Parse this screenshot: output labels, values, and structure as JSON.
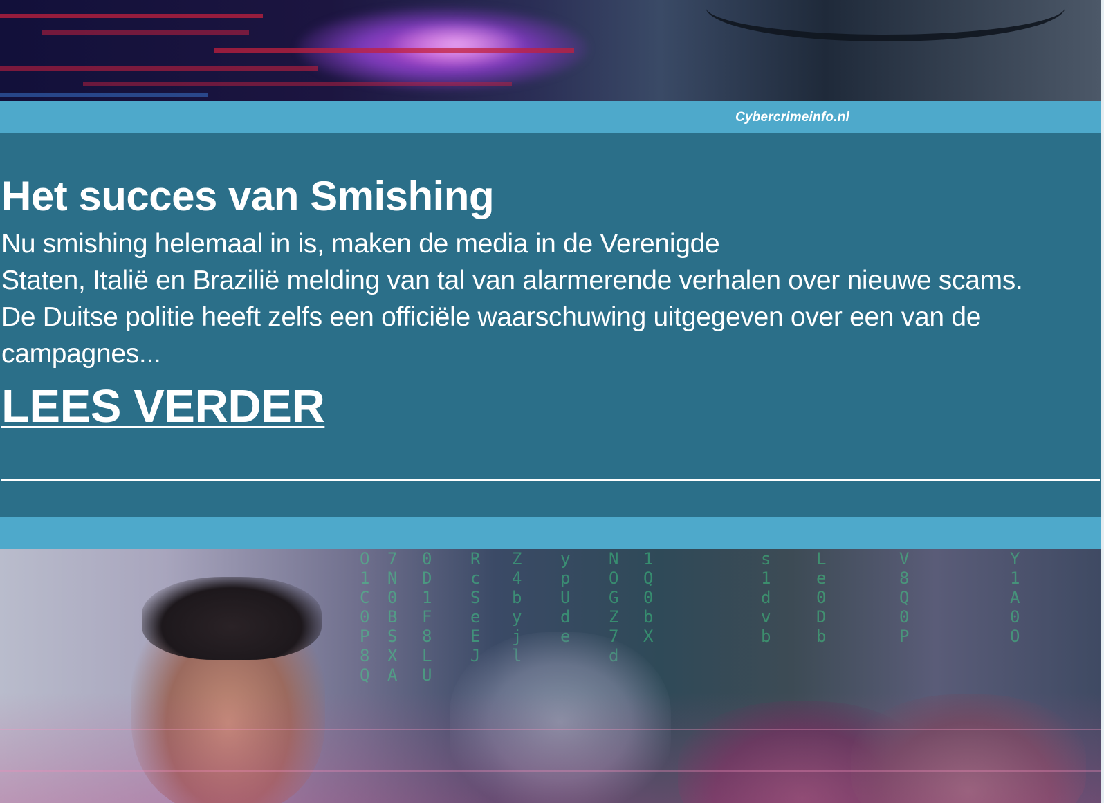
{
  "hero_top": {
    "caption": "Cybercrimeinfo.nl"
  },
  "article": {
    "title": "Het succes van Smishing",
    "body_lines": [
      "Nu smishing helemaal in is, maken de media in de Verenigde",
      "Staten, Italië en Brazilië melding van tal van alarmerende verhalen over nieuwe scams.",
      "De Duitse politie heeft zelfs een officiële waarschuwing uitgegeven over een van de",
      "campagnes..."
    ],
    "read_more_label": "LEES VERDER"
  },
  "colors": {
    "background": "#2b6f89",
    "caption_bar": "#4ea9cb",
    "text": "#ffffff"
  }
}
